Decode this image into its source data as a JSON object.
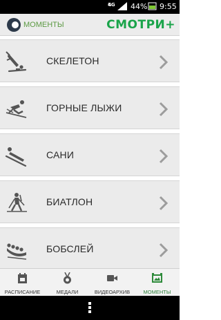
{
  "status_bar": {
    "network": "4G",
    "battery_percent": "44%",
    "time": "9:55"
  },
  "header": {
    "moments_label": "МОМЕНТЫ",
    "logo_text": "СМОТРИ+"
  },
  "sports": [
    {
      "label": "СКЕЛЕТОН",
      "icon": "skeleton-icon"
    },
    {
      "label": "ГОРНЫЕ ЛЫЖИ",
      "icon": "alpine-skiing-icon"
    },
    {
      "label": "САНИ",
      "icon": "luge-icon"
    },
    {
      "label": "БИАТЛОН",
      "icon": "biathlon-icon"
    },
    {
      "label": "БОБСЛЕЙ",
      "icon": "bobsleigh-icon"
    }
  ],
  "bottom_nav": [
    {
      "label": "РАСПИСАНИЕ",
      "icon": "schedule-icon",
      "active": false
    },
    {
      "label": "МЕДАЛИ",
      "icon": "medal-icon",
      "active": false
    },
    {
      "label": "ВИДЕОАРХИВ",
      "icon": "video-camera-icon",
      "active": false
    },
    {
      "label": "МОМЕНТЫ",
      "icon": "moments-icon",
      "active": true
    }
  ],
  "colors": {
    "brand_green": "#1aa44a",
    "active_green": "#2d7f3a",
    "header_bg": "#ececec",
    "item_bg": "#ebebeb"
  }
}
